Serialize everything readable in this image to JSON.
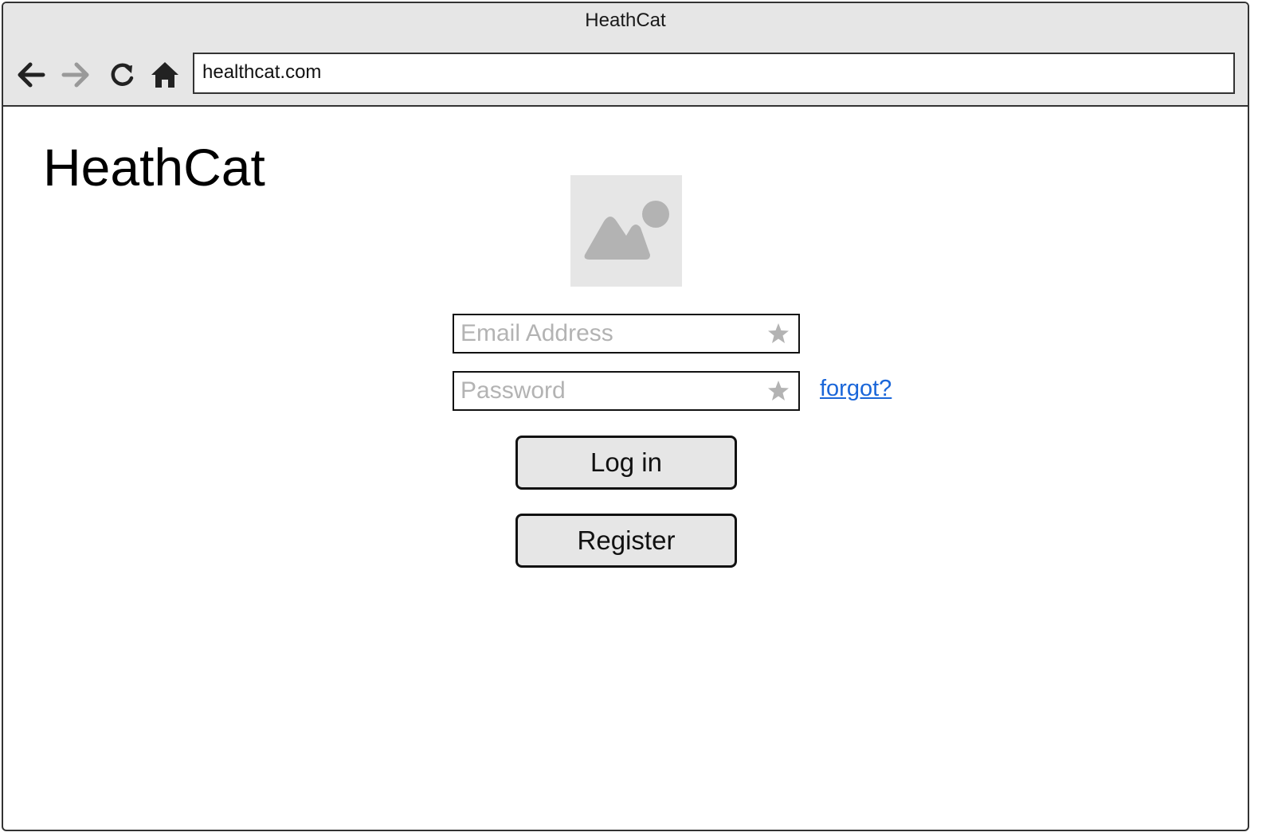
{
  "window": {
    "title": "HeathCat"
  },
  "toolbar": {
    "back_icon": "arrow-left-icon",
    "forward_icon": "arrow-right-icon",
    "reload_icon": "reload-icon",
    "home_icon": "home-icon",
    "url": "healthcat.com"
  },
  "page": {
    "brand": "HeathCat",
    "logo_icon": "image-placeholder-icon",
    "email_placeholder": "Email Address",
    "password_placeholder": "Password",
    "required_icon": "star-icon",
    "forgot_label": "forgot?",
    "login_label": "Log in",
    "register_label": "Register"
  },
  "colors": {
    "chrome_bg": "#e6e6e6",
    "link": "#1a66d9",
    "placeholder_text": "#b3b3b3",
    "disabled_icon": "#999999",
    "button_bg": "#e6e6e6"
  }
}
